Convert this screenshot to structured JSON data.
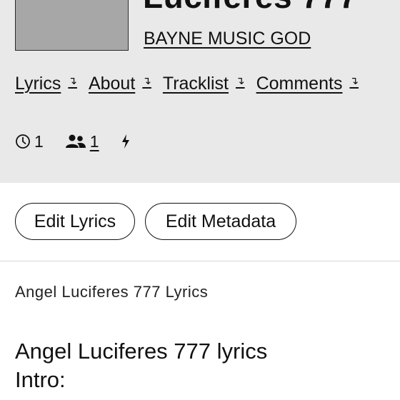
{
  "song": {
    "title": "Luciferes 777",
    "artist": "BAYNE MUSIC GOD"
  },
  "nav": {
    "items": [
      {
        "label": "Lyrics",
        "arrow": "↴"
      },
      {
        "label": "About",
        "arrow": "↴"
      },
      {
        "label": "Tracklist",
        "arrow": "↴"
      },
      {
        "label": "Comments",
        "arrow": "↴"
      }
    ]
  },
  "stats": {
    "views": "1",
    "contributors": "1"
  },
  "actions": {
    "edit_lyrics": "Edit Lyrics",
    "edit_metadata": "Edit Metadata"
  },
  "lyrics": {
    "heading": "Angel Luciferes 777 Lyrics",
    "lines": [
      "Angel Luciferes 777 lyrics",
      "Intro:"
    ]
  },
  "colors": {
    "header_bg": "#e9e9e9",
    "cover_bg": "#a7a7a7",
    "text": "#111111"
  },
  "icons": {
    "views": "clock-icon",
    "contributors": "people-icon",
    "pyongs": "lightning-icon"
  }
}
